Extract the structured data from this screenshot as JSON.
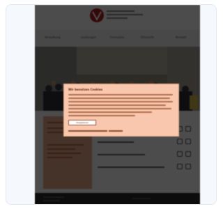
{
  "nav": {
    "items": [
      {
        "label": "Verwaltung",
        "icon": "none"
      },
      {
        "label": "Leistungen",
        "icon": "none"
      },
      {
        "label": "Formulare",
        "icon": "none"
      },
      {
        "label": "Ortsrecht",
        "icon": "none"
      },
      {
        "label": "Kontakt",
        "icon": "none"
      }
    ]
  },
  "cookie_dialog": {
    "title": "Wir benutzen Cookies",
    "button_label": "Akzeptieren",
    "icon": "none"
  },
  "colors": {
    "accent": "#e8a986",
    "dialog_bg": "#f8c7ae",
    "overlay": "#000000",
    "logo_red": "#b01e23"
  },
  "downloads": {
    "icons": [
      "download-icon",
      "pdf-icon"
    ]
  }
}
